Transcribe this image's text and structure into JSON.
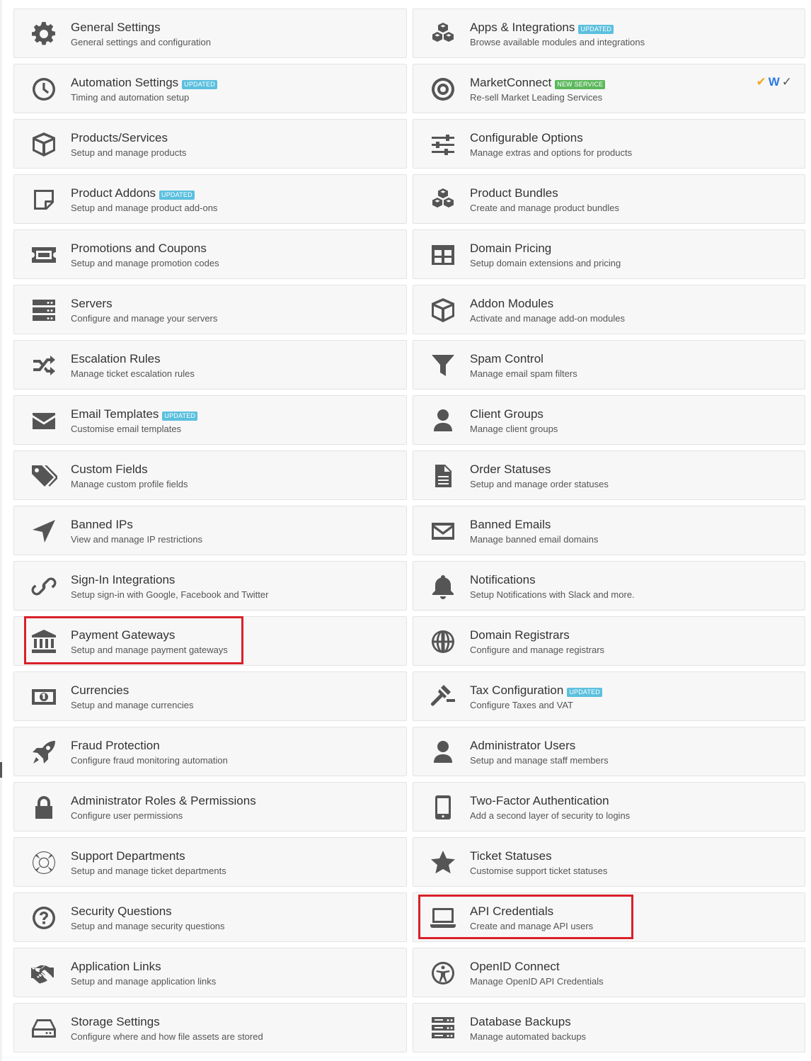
{
  "colors": {
    "badge_updated": "#5bc0de",
    "badge_new": "#5cb85c",
    "highlight": "#d9202a",
    "icon": "#555555"
  },
  "tiles": [
    {
      "title": "General Settings",
      "desc": "General settings and configuration",
      "icon": "gear-icon"
    },
    {
      "title": "Apps & Integrations",
      "desc": "Browse available modules and integrations",
      "icon": "cubes-icon",
      "badge": "Updated"
    },
    {
      "title": "Automation Settings",
      "desc": "Timing and automation setup",
      "icon": "clock-icon",
      "badge": "Updated"
    },
    {
      "title": "MarketConnect",
      "desc": "Re-sell Market Leading Services",
      "icon": "bullseye-icon",
      "badge": "New Service",
      "logos": [
        "✔",
        "W",
        "✓"
      ]
    },
    {
      "title": "Products/Services",
      "desc": "Setup and manage products",
      "icon": "cube-icon"
    },
    {
      "title": "Configurable Options",
      "desc": "Manage extras and options for products",
      "icon": "sliders-icon"
    },
    {
      "title": "Product Addons",
      "desc": "Setup and manage product add-ons",
      "icon": "sticky-note-icon",
      "badge": "Updated"
    },
    {
      "title": "Product Bundles",
      "desc": "Create and manage product bundles",
      "icon": "cubes-icon"
    },
    {
      "title": "Promotions and Coupons",
      "desc": "Setup and manage promotion codes",
      "icon": "ticket-icon"
    },
    {
      "title": "Domain Pricing",
      "desc": "Setup domain extensions and pricing",
      "icon": "table-icon"
    },
    {
      "title": "Servers",
      "desc": "Configure and manage your servers",
      "icon": "server-icon"
    },
    {
      "title": "Addon Modules",
      "desc": "Activate and manage add-on modules",
      "icon": "cube-icon"
    },
    {
      "title": "Escalation Rules",
      "desc": "Manage ticket escalation rules",
      "icon": "random-icon"
    },
    {
      "title": "Spam Control",
      "desc": "Manage email spam filters",
      "icon": "filter-icon"
    },
    {
      "title": "Email Templates",
      "desc": "Customise email templates",
      "icon": "envelope-icon",
      "badge": "Updated"
    },
    {
      "title": "Client Groups",
      "desc": "Manage client groups",
      "icon": "user-icon"
    },
    {
      "title": "Custom Fields",
      "desc": "Manage custom profile fields",
      "icon": "tags-icon"
    },
    {
      "title": "Order Statuses",
      "desc": "Setup and manage order statuses",
      "icon": "file-icon"
    },
    {
      "title": "Banned IPs",
      "desc": "View and manage IP restrictions",
      "icon": "location-arrow-icon"
    },
    {
      "title": "Banned Emails",
      "desc": "Manage banned email domains",
      "icon": "envelope-outline-icon"
    },
    {
      "title": "Sign-In Integrations",
      "desc": "Setup sign-in with Google, Facebook and Twitter",
      "icon": "link-icon"
    },
    {
      "title": "Notifications",
      "desc": "Setup Notifications with Slack and more.",
      "icon": "bell-icon"
    },
    {
      "title": "Payment Gateways",
      "desc": "Setup and manage payment gateways",
      "icon": "bank-icon"
    },
    {
      "title": "Domain Registrars",
      "desc": "Configure and manage registrars",
      "icon": "globe-icon"
    },
    {
      "title": "Currencies",
      "desc": "Setup and manage currencies",
      "icon": "money-icon"
    },
    {
      "title": "Tax Configuration",
      "desc": "Configure Taxes and VAT",
      "icon": "gavel-icon",
      "badge": "Updated"
    },
    {
      "title": "Fraud Protection",
      "desc": "Configure fraud monitoring automation",
      "icon": "rocket-icon"
    },
    {
      "title": "Administrator Users",
      "desc": "Setup and manage staff members",
      "icon": "user-icon"
    },
    {
      "title": "Administrator Roles & Permissions",
      "desc": "Configure user permissions",
      "icon": "lock-icon"
    },
    {
      "title": "Two-Factor Authentication",
      "desc": "Add a second layer of security to logins",
      "icon": "mobile-icon"
    },
    {
      "title": "Support Departments",
      "desc": "Setup and manage ticket departments",
      "icon": "life-ring-icon"
    },
    {
      "title": "Ticket Statuses",
      "desc": "Customise support ticket statuses",
      "icon": "star-icon"
    },
    {
      "title": "Security Questions",
      "desc": "Setup and manage security questions",
      "icon": "question-circle-icon"
    },
    {
      "title": "API Credentials",
      "desc": "Create and manage API users",
      "icon": "laptop-icon"
    },
    {
      "title": "Application Links",
      "desc": "Setup and manage application links",
      "icon": "handshake-icon"
    },
    {
      "title": "OpenID Connect",
      "desc": "Manage OpenID API Credentials",
      "icon": "accessibility-icon"
    },
    {
      "title": "Storage Settings",
      "desc": "Configure where and how file assets are stored",
      "icon": "hdd-icon"
    },
    {
      "title": "Database Backups",
      "desc": "Manage automated backups",
      "icon": "database-icon"
    }
  ],
  "highlighted_tiles": [
    "Payment Gateways",
    "API Credentials"
  ]
}
